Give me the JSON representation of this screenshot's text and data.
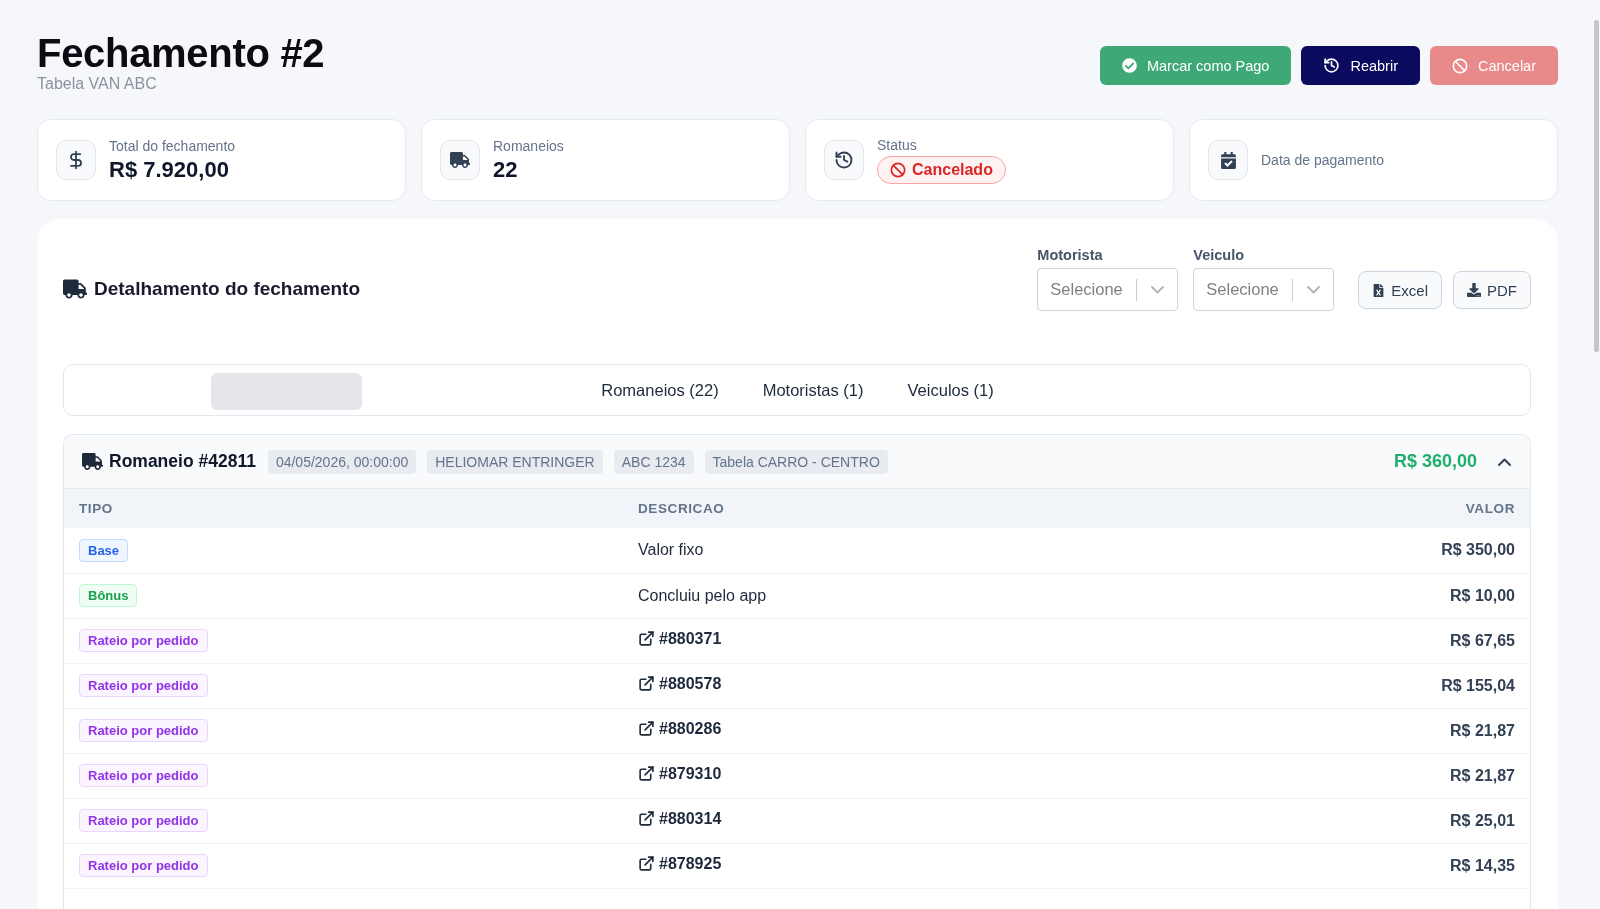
{
  "header": {
    "title": "Fechamento #2",
    "subtitle": "Tabela VAN ABC",
    "actions": [
      {
        "kind": "pay",
        "label": "Marcar como Pago",
        "disabled": false
      },
      {
        "kind": "reopen",
        "label": "Reabrir",
        "disabled": false
      },
      {
        "kind": "cancel",
        "label": "Cancelar",
        "disabled": true
      }
    ]
  },
  "stats": [
    {
      "kind": "money",
      "label": "Total do fechamento",
      "value": "R$ 7.920,00"
    },
    {
      "kind": "truck",
      "label": "Romaneios",
      "value": "22"
    },
    {
      "kind": "status",
      "label": "Status",
      "badge": "Cancelado"
    },
    {
      "kind": "calendar",
      "label": "Data de pagamento"
    }
  ],
  "detail": {
    "title": "Detalhamento do fechamento",
    "filters": [
      {
        "label": "Motorista",
        "placeholder": "Selecione"
      },
      {
        "label": "Veiculo",
        "placeholder": "Selecione"
      }
    ],
    "exports": [
      {
        "kind": "excel",
        "label": "Excel"
      },
      {
        "kind": "pdf",
        "label": "PDF"
      }
    ],
    "tabs": [
      {
        "label": "Romaneios (22)",
        "selected": false
      },
      {
        "label": "Motoristas (1)",
        "selected": false
      },
      {
        "label": "Veiculos (1)",
        "selected": false
      }
    ],
    "romaneios": [
      {
        "title": "Romaneio #42811",
        "chips": [
          "04/05/2026, 00:00:00",
          "HELIOMAR ENTRINGER",
          "ABC 1234",
          "Tabela CARRO - CENTRO"
        ],
        "total": "R$ 360,00",
        "expanded": true,
        "columns": [
          "TIPO",
          "DESCRICAO",
          "VALOR"
        ],
        "rows": [
          {
            "kind": "base",
            "type": "Base",
            "description": "Valor fixo",
            "value": "R$ 350,00"
          },
          {
            "kind": "bonus",
            "type": "Bônus",
            "description": "Concluiu pelo app",
            "value": "R$ 10,00"
          },
          {
            "kind": "rateio",
            "type": "Rateio por pedido",
            "description": "#880371",
            "value": "R$ 67,65"
          },
          {
            "kind": "rateio",
            "type": "Rateio por pedido",
            "description": "#880578",
            "value": "R$ 155,04"
          },
          {
            "kind": "rateio",
            "type": "Rateio por pedido",
            "description": "#880286",
            "value": "R$ 21,87"
          },
          {
            "kind": "rateio",
            "type": "Rateio por pedido",
            "description": "#879310",
            "value": "R$ 21,87"
          },
          {
            "kind": "rateio",
            "type": "Rateio por pedido",
            "description": "#880314",
            "value": "R$ 25,01"
          },
          {
            "kind": "rateio",
            "type": "Rateio por pedido",
            "description": "#878925",
            "value": "R$ 14,35"
          }
        ]
      }
    ]
  }
}
